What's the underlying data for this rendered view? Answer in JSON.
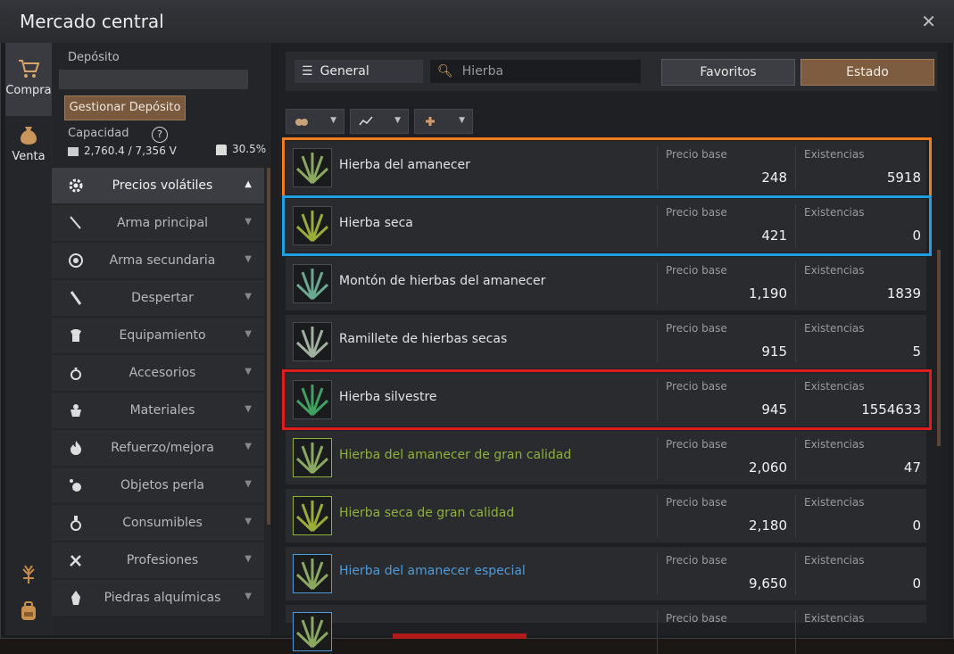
{
  "window": {
    "title": "Mercado central",
    "close_label": "✕"
  },
  "rail": {
    "buy_label": "Compra",
    "sell_label": "Venta"
  },
  "sidebar": {
    "deposit_label": "Depósito",
    "manage_button": "Gestionar Depósito",
    "capacity_label": "Capacidad",
    "help": "?",
    "capacity_value": "2,760.4 / 7,356 V",
    "weight_percent": "30.5%",
    "categories": [
      {
        "label": "Precios volátiles",
        "icon": "gear-icon",
        "arrow": "▲"
      },
      {
        "label": "Arma principal",
        "icon": "sword-icon",
        "arrow": "▼"
      },
      {
        "label": "Arma secundaria",
        "icon": "shield-icon",
        "arrow": "▼"
      },
      {
        "label": "Despertar",
        "icon": "blade-icon",
        "arrow": "▼"
      },
      {
        "label": "Equipamiento",
        "icon": "armor-icon",
        "arrow": "▼"
      },
      {
        "label": "Accesorios",
        "icon": "ring-icon",
        "arrow": "▼"
      },
      {
        "label": "Materiales",
        "icon": "ore-icon",
        "arrow": "▼"
      },
      {
        "label": "Refuerzo/mejora",
        "icon": "flame-icon",
        "arrow": "▼"
      },
      {
        "label": "Objetos perla",
        "icon": "pearl-icon",
        "arrow": "▼"
      },
      {
        "label": "Consumibles",
        "icon": "potion-icon",
        "arrow": "▼"
      },
      {
        "label": "Profesiones",
        "icon": "tools-icon",
        "arrow": "▼"
      },
      {
        "label": "Piedras alquímicas",
        "icon": "stone-icon",
        "arrow": "▼"
      }
    ]
  },
  "toolbar": {
    "general_label": "General",
    "search_value": "Hierba",
    "favorites_label": "Favoritos",
    "status_label": "Estado"
  },
  "list": {
    "price_header": "Precio base",
    "stock_header": "Existencias",
    "items": [
      {
        "name": "Hierba del amanecer",
        "price": "248",
        "stock": "5918",
        "grade": "white",
        "highlight": "#f07c1e"
      },
      {
        "name": "Hierba seca",
        "price": "421",
        "stock": "0",
        "grade": "white",
        "highlight": "#1e9fe0"
      },
      {
        "name": "Montón de hierbas del amanecer",
        "price": "1,190",
        "stock": "1839",
        "grade": "white",
        "highlight": ""
      },
      {
        "name": "Ramillete de hierbas secas",
        "price": "915",
        "stock": "5",
        "grade": "white",
        "highlight": ""
      },
      {
        "name": "Hierba silvestre",
        "price": "945",
        "stock": "1554633",
        "grade": "white",
        "highlight": "#e01c1c"
      },
      {
        "name": "Hierba del amanecer de gran calidad",
        "price": "2,060",
        "stock": "47",
        "grade": "green",
        "highlight": ""
      },
      {
        "name": "Hierba seca de gran calidad",
        "price": "2,180",
        "stock": "0",
        "grade": "green",
        "highlight": ""
      },
      {
        "name": "Hierba del amanecer especial",
        "price": "9,650",
        "stock": "0",
        "grade": "blue",
        "highlight": ""
      },
      {
        "name": "",
        "price": "",
        "stock": "",
        "grade": "blue",
        "highlight": ""
      }
    ]
  }
}
